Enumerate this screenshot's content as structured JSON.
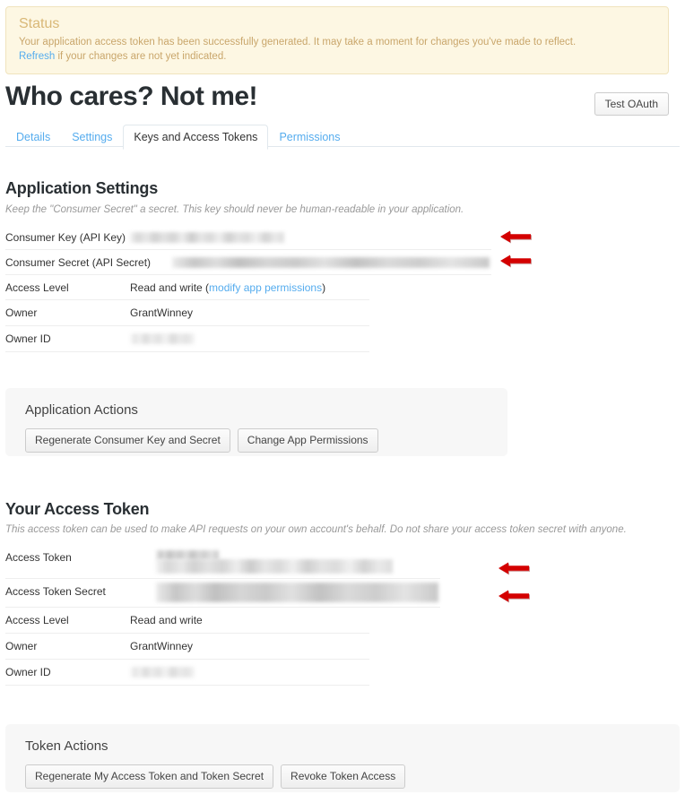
{
  "status": {
    "title": "Status",
    "message": "Your application access token has been successfully generated. It may take a moment for changes you've made to reflect.",
    "refresh_label": "Refresh",
    "refresh_suffix": " if your changes are not yet indicated.",
    "bg_color": "#fdf7e3",
    "border_color": "#f0e3bd",
    "text_color": "#c9a66b",
    "link_color": "#55acee"
  },
  "header": {
    "app_title": "Who cares? Not me!",
    "test_oauth_label": "Test OAuth"
  },
  "tabs": [
    {
      "label": "Details",
      "active": false
    },
    {
      "label": "Settings",
      "active": false
    },
    {
      "label": "Keys and Access Tokens",
      "active": true
    },
    {
      "label": "Permissions",
      "active": false
    }
  ],
  "application_settings": {
    "title": "Application Settings",
    "subtitle": "Keep the \"Consumer Secret\" a secret. This key should never be human-readable in your application.",
    "rows": [
      {
        "label": "Consumer Key (API Key)",
        "value": "",
        "redacted": true
      },
      {
        "label": "Consumer Secret (API Secret)",
        "value": "",
        "redacted": true
      },
      {
        "label": "Access Level",
        "value": "Read and write (",
        "link": "modify app permissions",
        "value_suffix": ")",
        "redacted": false
      },
      {
        "label": "Owner",
        "value": "GrantWinney",
        "redacted": false
      },
      {
        "label": "Owner ID",
        "value": "",
        "redacted": true
      }
    ]
  },
  "application_actions": {
    "title": "Application Actions",
    "buttons": [
      "Regenerate Consumer Key and Secret",
      "Change App Permissions"
    ]
  },
  "access_token": {
    "title": "Your Access Token",
    "subtitle": "This access token can be used to make API requests on your own account's behalf. Do not share your access token secret with anyone.",
    "rows": [
      {
        "label": "Access Token",
        "value": "",
        "redacted": true
      },
      {
        "label": "Access Token Secret",
        "value": "",
        "redacted": true
      },
      {
        "label": "Access Level",
        "value": "Read and write",
        "redacted": false
      },
      {
        "label": "Owner",
        "value": "GrantWinney",
        "redacted": false
      },
      {
        "label": "Owner ID",
        "value": "",
        "redacted": true
      }
    ]
  },
  "token_actions": {
    "title": "Token Actions",
    "buttons": [
      "Regenerate My Access Token and Token Secret",
      "Revoke Token Access"
    ]
  },
  "annotations": {
    "arrow_color": "#d40000",
    "count": 4
  }
}
